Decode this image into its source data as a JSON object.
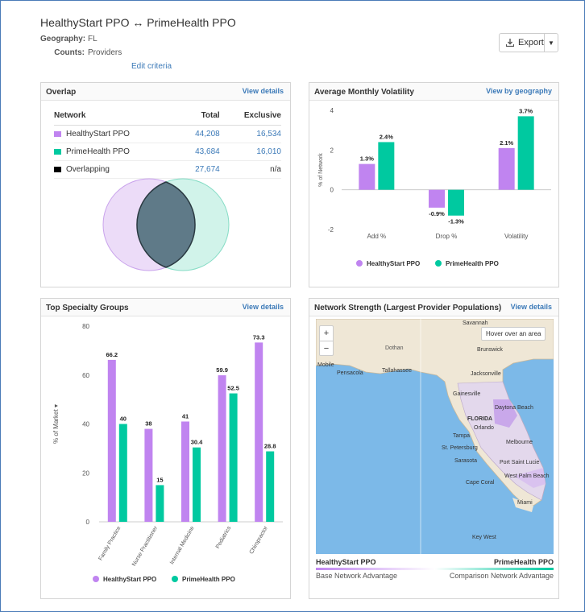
{
  "header": {
    "title": "HealthyStart PPO ↔ PrimeHealth PPO",
    "geography_label": "Geography:",
    "geography_value": "FL",
    "counts_label": "Counts:",
    "counts_value": "Providers",
    "edit_link": "Edit criteria",
    "export_label": "Export"
  },
  "colors": {
    "healthystart": "#c084f0",
    "primehealth": "#00c9a0",
    "overlap": "#000000",
    "link": "#3c7ab8"
  },
  "overlap": {
    "title": "Overlap",
    "action": "View details",
    "columns": [
      "Network",
      "Total",
      "Exclusive"
    ],
    "rows": [
      {
        "name": "HealthyStart PPO",
        "total": "44,208",
        "exclusive": "16,534"
      },
      {
        "name": "PrimeHealth PPO",
        "total": "43,684",
        "exclusive": "16,010"
      },
      {
        "name": "Overlapping",
        "total": "27,674",
        "exclusive": "n/a"
      }
    ]
  },
  "volatility": {
    "title": "Average Monthly Volatility",
    "action": "View by geography",
    "chart_data": {
      "type": "bar",
      "categories": [
        "Add %",
        "Drop %",
        "Volatility"
      ],
      "series": [
        {
          "name": "HealthyStart PPO",
          "values": [
            1.3,
            -0.9,
            2.1
          ],
          "labels": [
            "1.3%",
            "-0.9%",
            "2.1%"
          ]
        },
        {
          "name": "PrimeHealth PPO",
          "values": [
            2.4,
            -1.3,
            3.7
          ],
          "labels": [
            "2.4%",
            "-1.3%",
            "3.7%"
          ]
        }
      ],
      "ylabel": "% of Network",
      "ylim": [
        -2,
        4
      ],
      "yticks": [
        "4",
        "2",
        "0",
        "-2"
      ]
    }
  },
  "specialty": {
    "title": "Top Specialty Groups",
    "action": "View details",
    "chart_data": {
      "type": "bar",
      "categories": [
        "Family Practice",
        "Nurse Practitioner",
        "Internal Medicine",
        "Pediatrics",
        "Chiropractor"
      ],
      "series": [
        {
          "name": "HealthyStart PPO",
          "values": [
            66.2,
            38,
            41,
            59.9,
            73.3
          ],
          "labels": [
            "66.2",
            "38",
            "41",
            "59.9",
            "73.3"
          ]
        },
        {
          "name": "PrimeHealth PPO",
          "values": [
            40,
            15,
            30.4,
            52.5,
            28.8
          ],
          "labels": [
            "40",
            "15",
            "30.4",
            "52.5",
            "28.8"
          ]
        }
      ],
      "ylabel": "% of Market ▾",
      "ylim": [
        0,
        80
      ],
      "yticks": [
        "80",
        "60",
        "40",
        "20",
        "0"
      ]
    }
  },
  "strength": {
    "title": "Network Strength (Largest Provider Populations)",
    "action": "View details",
    "zoom_in": "+",
    "zoom_out": "−",
    "hover_hint": "Hover over an area",
    "places": [
      "Savannah",
      "Brunswick",
      "Dothan",
      "Mobile",
      "Pensacola",
      "Tallahassee",
      "Jacksonville",
      "Gainesville",
      "Daytona Beach",
      "FLORIDA",
      "Orlando",
      "Tampa",
      "Melbourne",
      "St. Petersburg",
      "Port Saint Lucie",
      "Sarasota",
      "West Palm Beach",
      "Cape Coral",
      "Miami",
      "Key West"
    ],
    "legend_left": "HealthyStart PPO",
    "legend_right": "PrimeHealth PPO",
    "legend_left_sub": "Base Network Advantage",
    "legend_right_sub": "Comparison Network Advantage"
  }
}
